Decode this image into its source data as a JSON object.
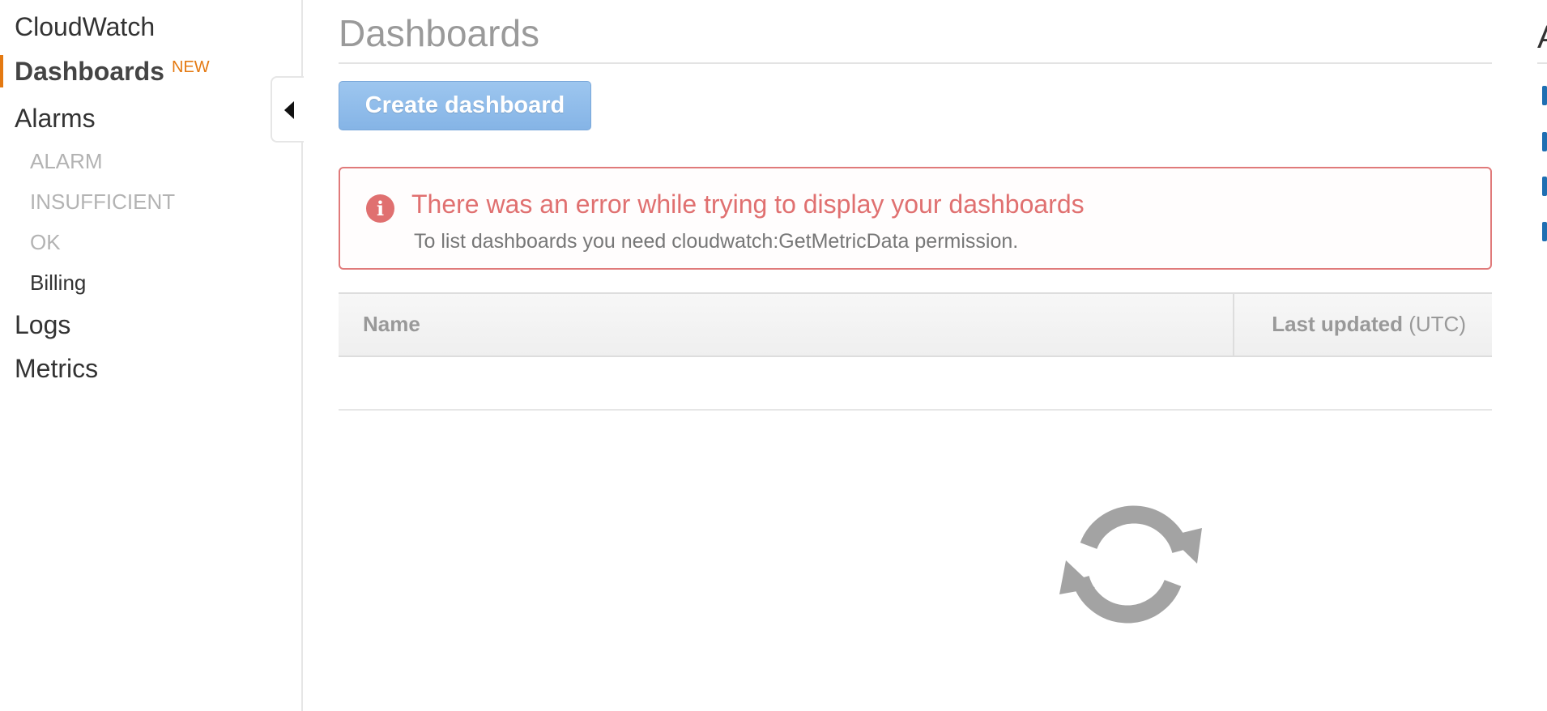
{
  "sidebar": {
    "items": [
      {
        "label": "CloudWatch"
      },
      {
        "label": "Dashboards",
        "badge": "NEW",
        "active": true
      },
      {
        "label": "Alarms"
      },
      {
        "label": "ALARM",
        "enabled": false
      },
      {
        "label": "INSUFFICIENT",
        "enabled": false
      },
      {
        "label": "OK",
        "enabled": false
      },
      {
        "label": "Billing",
        "enabled": true
      },
      {
        "label": "Logs"
      },
      {
        "label": "Metrics"
      }
    ],
    "accent_color": "#e47911"
  },
  "main": {
    "title": "Dashboards",
    "create_button_label": "Create dashboard",
    "error": {
      "title": "There was an error while trying to display your dashboards",
      "message": "To list dashboards you need cloudwatch:GetMetricData permission.",
      "icon": "info-icon",
      "color": "#e07070"
    },
    "table": {
      "columns": [
        {
          "label": "Name"
        },
        {
          "label": "Last updated",
          "suffix": "(UTC)"
        }
      ],
      "rows": []
    },
    "loading_icon": "refresh-icon"
  },
  "right_panel": {
    "heading": "A"
  }
}
